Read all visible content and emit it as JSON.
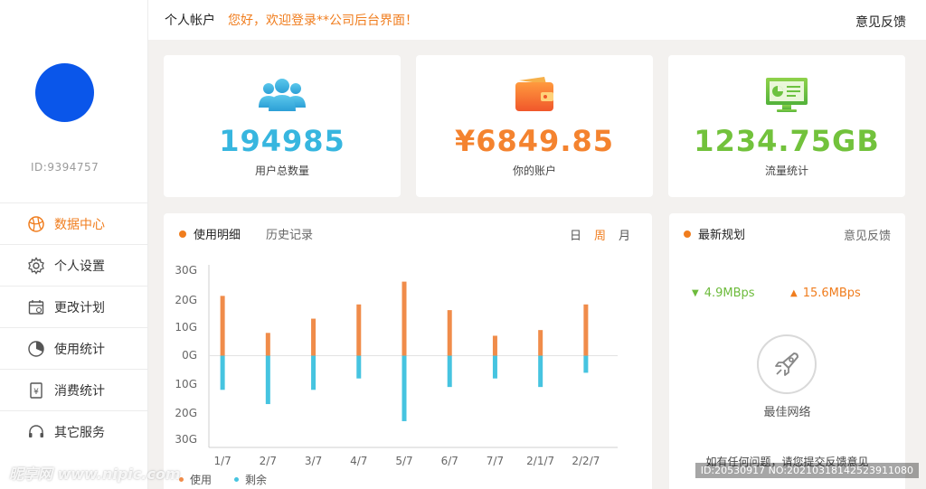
{
  "sidebar": {
    "user_id": "ID:9394757",
    "items": [
      {
        "label": "数据中心",
        "icon": "globe-icon",
        "active": true
      },
      {
        "label": "个人设置",
        "icon": "gear-icon",
        "active": false
      },
      {
        "label": "更改计划",
        "icon": "calendar-icon",
        "active": false
      },
      {
        "label": "使用统计",
        "icon": "pie-chart-icon",
        "active": false
      },
      {
        "label": "消费统计",
        "icon": "receipt-icon",
        "active": false
      },
      {
        "label": "其它服务",
        "icon": "headset-icon",
        "active": false
      }
    ]
  },
  "header": {
    "account": "个人帐户",
    "welcome": "您好，欢迎登录**公司后台界面！",
    "feedback": "意见反馈"
  },
  "stats": [
    {
      "value": "194985",
      "label": "用户总数量",
      "icon": "users-icon",
      "color": "#37b6df"
    },
    {
      "value": "¥6849.85",
      "label": "你的账户",
      "icon": "wallet-icon",
      "color": "#f4832f"
    },
    {
      "value": "1234.75GB",
      "label": "流量统计",
      "icon": "monitor-icon",
      "color": "#72c23c"
    }
  ],
  "usage_panel": {
    "title": "使用明细",
    "history": "历史记录",
    "periods": [
      "日",
      "周",
      "月"
    ],
    "active_period": "周",
    "legend": [
      "使用",
      "剩余"
    ]
  },
  "chart_data": {
    "type": "bar",
    "categories": [
      "1/7",
      "2/7",
      "3/7",
      "4/7",
      "5/7",
      "6/7",
      "7/7",
      "2/1/7",
      "2/2/7"
    ],
    "y_tick_labels": [
      "30G",
      "20G",
      "10G",
      "0G",
      "10G",
      "20G",
      "30G"
    ],
    "series": [
      {
        "name": "使用",
        "color": "#f08c4a",
        "values": [
          21,
          8,
          13,
          18,
          26,
          16,
          7,
          9,
          18
        ]
      },
      {
        "name": "剩余",
        "color": "#46c4e0",
        "values": [
          -12,
          -17,
          -12,
          -8,
          -23,
          -11,
          -8,
          -11,
          -6
        ]
      }
    ],
    "ylim": [
      -30,
      30
    ]
  },
  "plan_panel": {
    "title": "最新规划",
    "feedback": "意见反馈",
    "download": "4.9MBps",
    "upload": "15.6MBps",
    "best_network": "最佳网络",
    "help_text": "如有任何问题，请您提交反馈意见"
  },
  "watermark": {
    "left": "昵享网 www.nipic.com",
    "right": "ID:20530917 NO:20210318142523911080"
  }
}
